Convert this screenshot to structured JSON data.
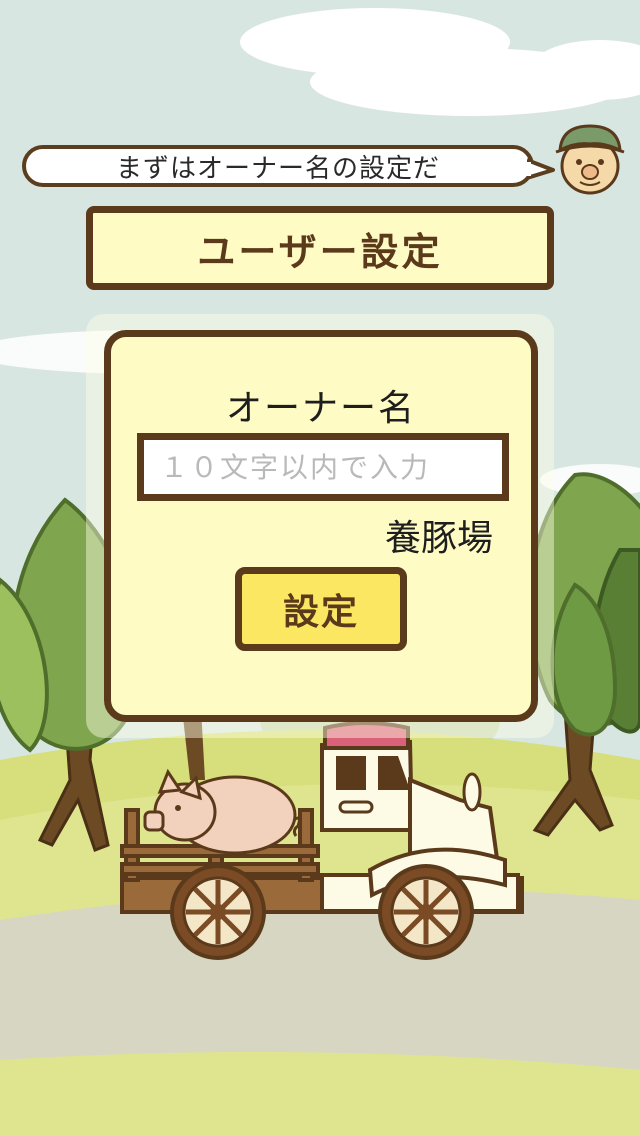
{
  "guide": {
    "message": "まずはオーナー名の設定だ",
    "avatar_icon": "farmer-icon"
  },
  "header": {
    "title": "ユーザー設定"
  },
  "form": {
    "owner_label": "オーナー名",
    "owner_input": {
      "value": "",
      "placeholder": "１０文字以内で入力"
    },
    "suffix_text": "養豚場",
    "submit_label": "設定"
  },
  "colors": {
    "border_brown": "#5b3a1c",
    "panel_cream": "#fefbc4",
    "button_yellow": "#fbe762",
    "sky": "#d8e6e2",
    "ground_green": "#d6df7c"
  }
}
